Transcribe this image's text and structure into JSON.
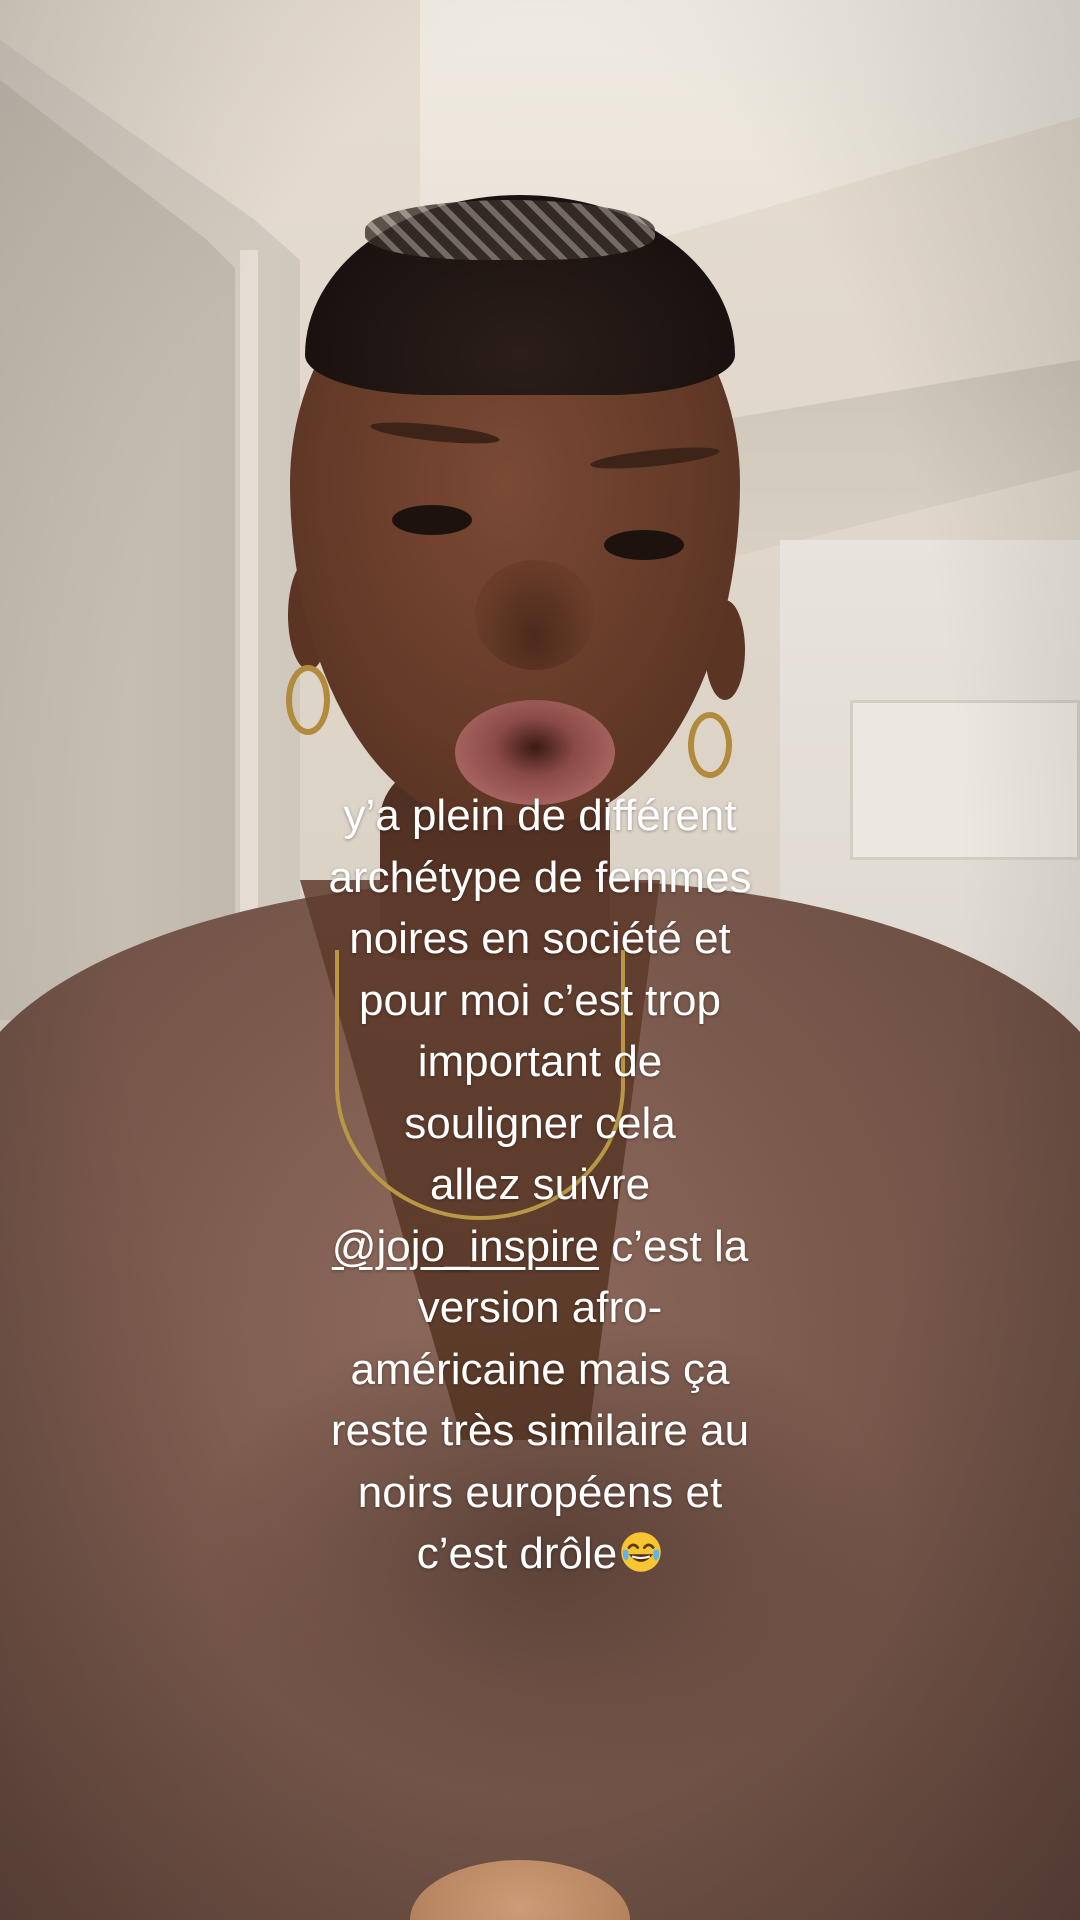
{
  "caption": {
    "lines": [
      "y’a plein de différent",
      "archétype de femmes",
      "noires en société et",
      "pour moi c’est trop",
      "important de",
      "souligner cela",
      "allez suivre"
    ],
    "mention": "@jojo_inspire",
    "mention_suffix": " c’est la",
    "lines_after": [
      "version afro-",
      "américaine mais ça",
      "reste très similaire au",
      "noirs européens et"
    ],
    "last_line": "c’est drôle",
    "emoji": "laughing-tears-emoji"
  },
  "colors": {
    "caption_text": "#ffffff",
    "shirt": "#7b5a4d",
    "wall": "#dcd3c7"
  }
}
